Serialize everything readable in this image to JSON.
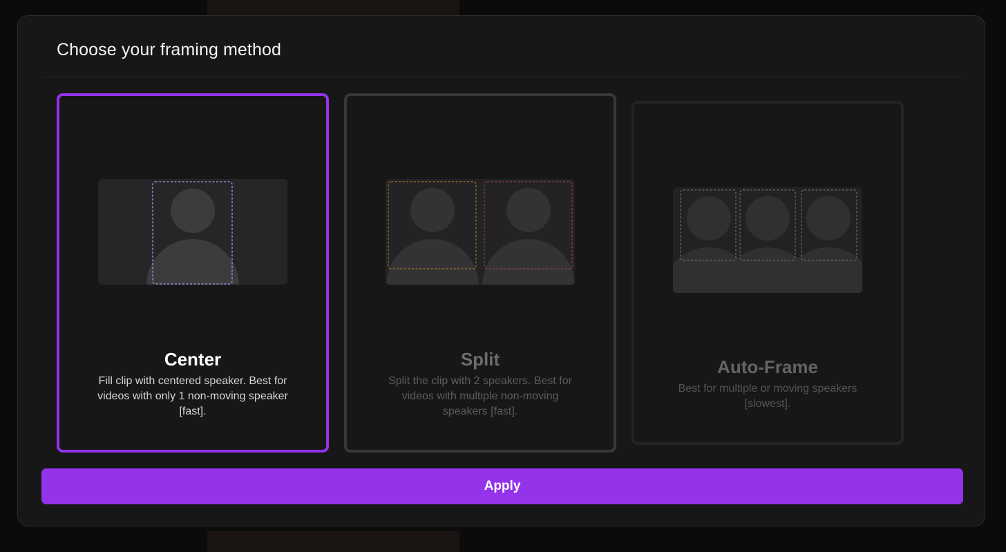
{
  "modal": {
    "title": "Choose your framing method",
    "apply_label": "Apply"
  },
  "options": [
    {
      "id": "center",
      "title": "Center",
      "description": "Fill clip with centered speaker. Best for videos with only 1 non-moving speaker [fast].",
      "selected": true
    },
    {
      "id": "split",
      "title": "Split",
      "description": "Split the clip with 2 speakers. Best for videos with multiple non-moving speakers [fast].",
      "selected": false
    },
    {
      "id": "auto-frame",
      "title": "Auto-Frame",
      "description": "Best for multiple or moving speakers [slowest].",
      "selected": false
    }
  ],
  "colors": {
    "accent": "#9333ea",
    "modal_bg": "#171718",
    "selected_frame": "#a99cf0",
    "split_frame_left": "#c9962a",
    "split_frame_right": "#c0475a",
    "auto_frame": "#8a8a8c"
  }
}
